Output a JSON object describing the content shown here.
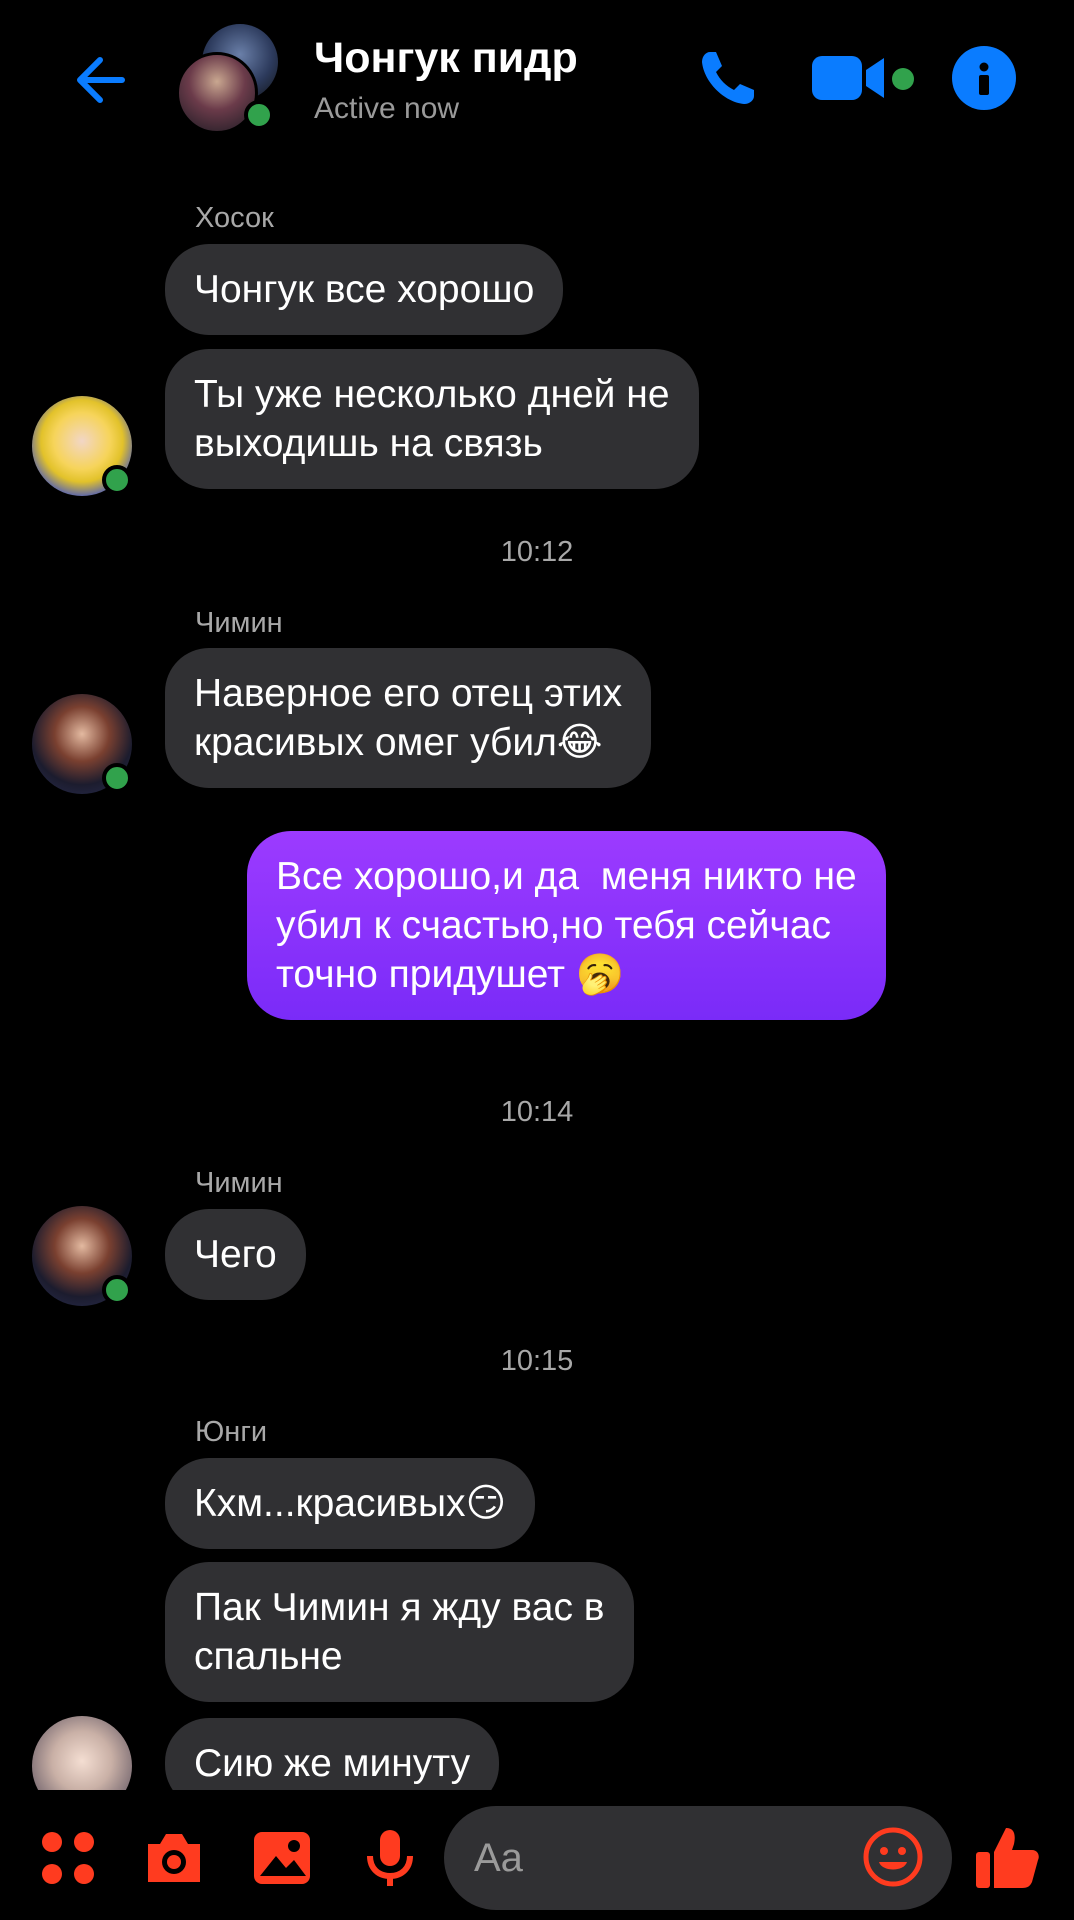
{
  "header": {
    "title": "Чонгук пидр",
    "subtitle": "Active now"
  },
  "messages": [
    {
      "sender": "Хосок",
      "bubbles": [
        "Чонгук все хорошо",
        "Ты уже несколько дней не\nвыходишь на связь"
      ]
    },
    {
      "time": "10:12"
    },
    {
      "sender": "Чимин",
      "bubbles": [
        "Наверное его отец этих\nкрасивых омег убил😂"
      ]
    },
    {
      "mine": "Все хорошо,и да  меня никто не\nубил к счастью,но тебя сейчас\nточно придушет 🥱"
    },
    {
      "time": "10:14"
    },
    {
      "sender": "Чимин",
      "bubbles": [
        "Чего"
      ]
    },
    {
      "time": "10:15"
    },
    {
      "sender": "Юнги",
      "bubbles": [
        "Кхм...красивых😏",
        "Пак Чимин я жду вас в\nспальне",
        "Сию же минуту"
      ]
    }
  ],
  "composer": {
    "placeholder": "Aa"
  },
  "colors": {
    "accent": "#0a7cff",
    "composer_icons": "#ff3b1f",
    "my_bubble": "#8a33ff",
    "their_bubble": "#303033",
    "online": "#31a24c"
  },
  "icons": {
    "header": [
      "back-arrow-icon",
      "phone-icon",
      "video-camera-icon",
      "info-icon"
    ],
    "composer": [
      "apps-icon",
      "camera-icon",
      "gallery-icon",
      "microphone-icon",
      "emoji-icon",
      "like-icon"
    ]
  }
}
